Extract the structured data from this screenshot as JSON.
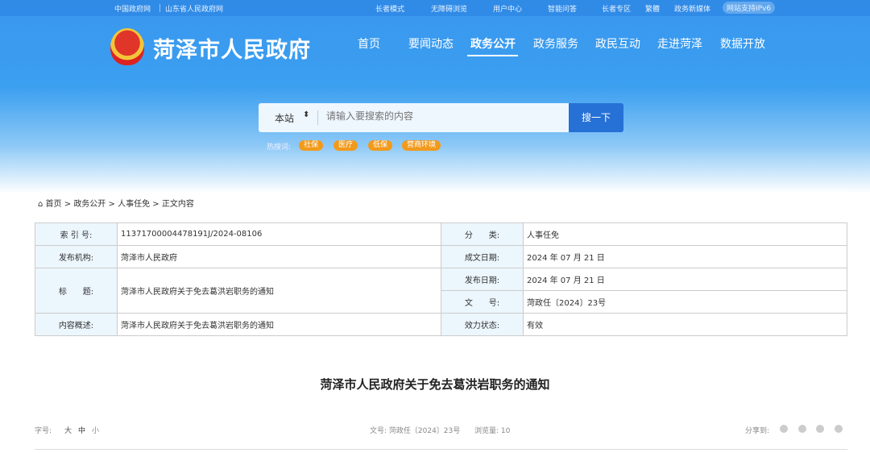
{
  "topbar": {
    "left": [
      "中国政府网",
      "山东省人民政府网"
    ],
    "right": [
      "长者模式",
      "无障碍浏览",
      "用户中心",
      "智能问答",
      "长者专区",
      "繁體",
      "政务新媒体",
      "网站支持IPv6"
    ]
  },
  "site": {
    "name": "菏泽市人民政府"
  },
  "nav": [
    "首页",
    "要闻动态",
    "政务公开",
    "政务服务",
    "政民互动",
    "走进菏泽",
    "数据开放"
  ],
  "search": {
    "scope": "本站",
    "placeholder": "请输入要搜索的内容",
    "button": "搜一下",
    "hot_label": "热搜词:",
    "hot": [
      "社保",
      "医疗",
      "低保",
      "营商环境"
    ]
  },
  "breadcrumb": [
    "首页",
    ">",
    "政务公开",
    ">",
    "人事任免",
    ">",
    "正文内容"
  ],
  "info": {
    "index_label": "索 引 号:",
    "index": "11371700004478191J/2024-08106",
    "category_label": "分　　类:",
    "category": "人事任免",
    "publisher_label": "发布机构:",
    "publisher": "菏泽市人民政府",
    "created_label": "成文日期:",
    "created": "2024 年 07 月 21 日",
    "title_label": "标　　题:",
    "title": "菏泽市人民政府关于免去葛洪岩职务的通知",
    "published_label": "发布日期:",
    "published": "2024 年 07 月 21 日",
    "docno_label": "文　　号:",
    "docno": "菏政任〔2024〕23号",
    "summary_label": "内容概述:",
    "summary": "菏泽市人民政府关于免去葛洪岩职务的通知",
    "status_label": "效力状态:",
    "status": "有效"
  },
  "article": {
    "title": "菏泽市人民政府关于免去葛洪岩职务的通知",
    "font_label": "字号:",
    "font_sizes": [
      "大",
      "中",
      "小"
    ],
    "docno": "文号: 菏政任〔2024〕23号",
    "views": "浏览量: 10",
    "share_label": "分享到:"
  }
}
